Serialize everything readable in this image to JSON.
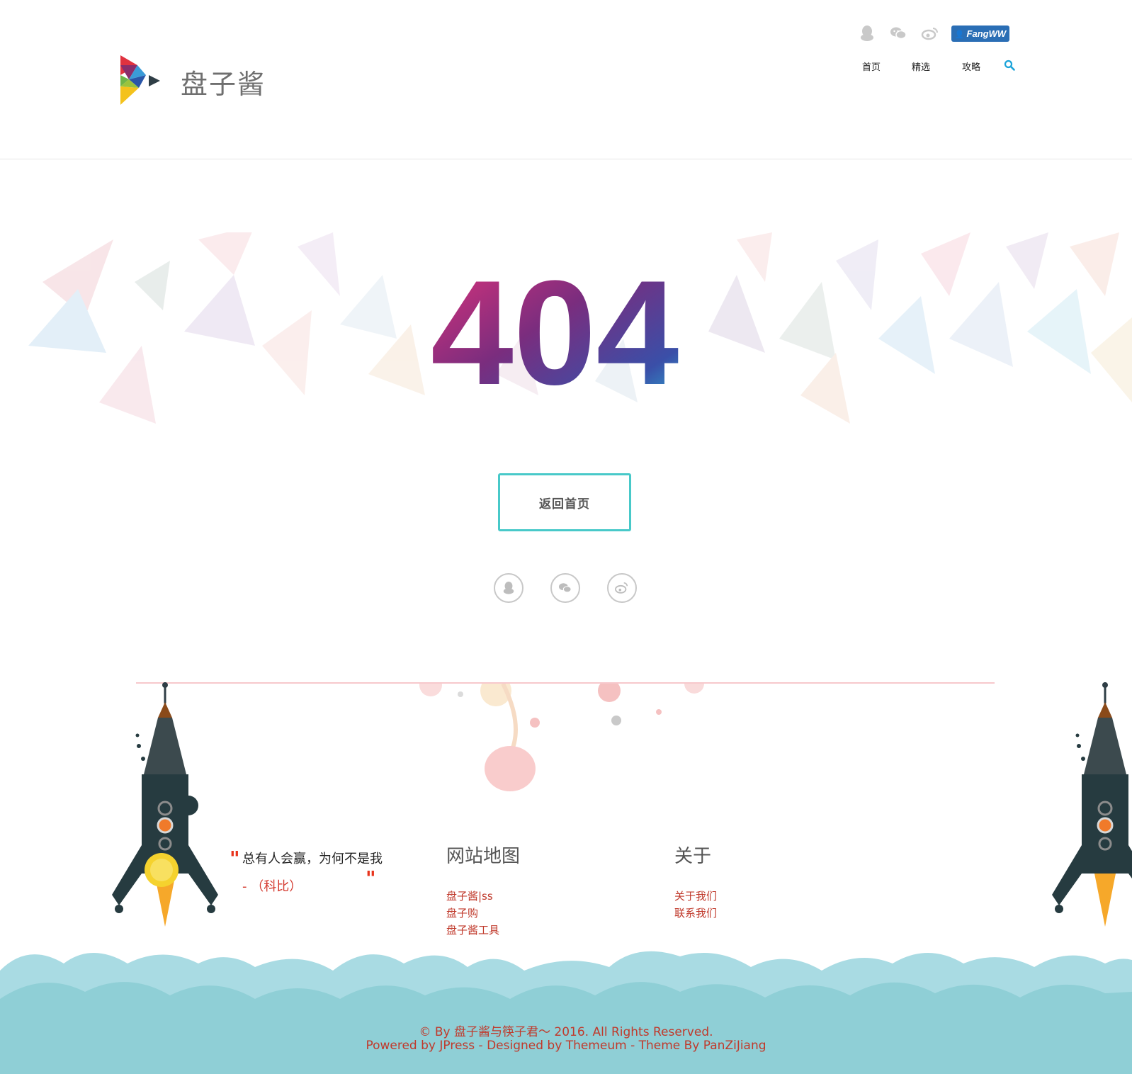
{
  "site": {
    "name": "盘子酱"
  },
  "header": {
    "social_icons": [
      "qq-icon",
      "wechat-icon",
      "weibo-icon"
    ],
    "user_badge": "FangWW",
    "nav": [
      {
        "label": "首页"
      },
      {
        "label": "精选"
      },
      {
        "label": "攻略"
      }
    ]
  },
  "error": {
    "code": "404",
    "home_button": "返回首页",
    "share_icons": [
      "qq-icon",
      "wechat-icon",
      "weibo-icon"
    ]
  },
  "footer": {
    "quote": {
      "text": "总有人会赢，为何不是我",
      "author": "- （科比）"
    },
    "sitemap": {
      "title": "网站地图",
      "links": [
        "盘子酱|ss",
        "盘子购",
        "盘子酱工具"
      ]
    },
    "about": {
      "title": "关于",
      "links": [
        "关于我们",
        "联系我们"
      ]
    },
    "copyright": "© By 盘子酱与筷子君～ 2016. All Rights Reserved.",
    "powered": "Powered by JPress - Designed by Themeum - Theme By PanZiJiang"
  },
  "colors": {
    "accent": "#48c9c9",
    "link": "#c0392b",
    "badge": "#2a6eb5",
    "search": "#1aa3d9",
    "cloud": "#8fcfd6"
  }
}
